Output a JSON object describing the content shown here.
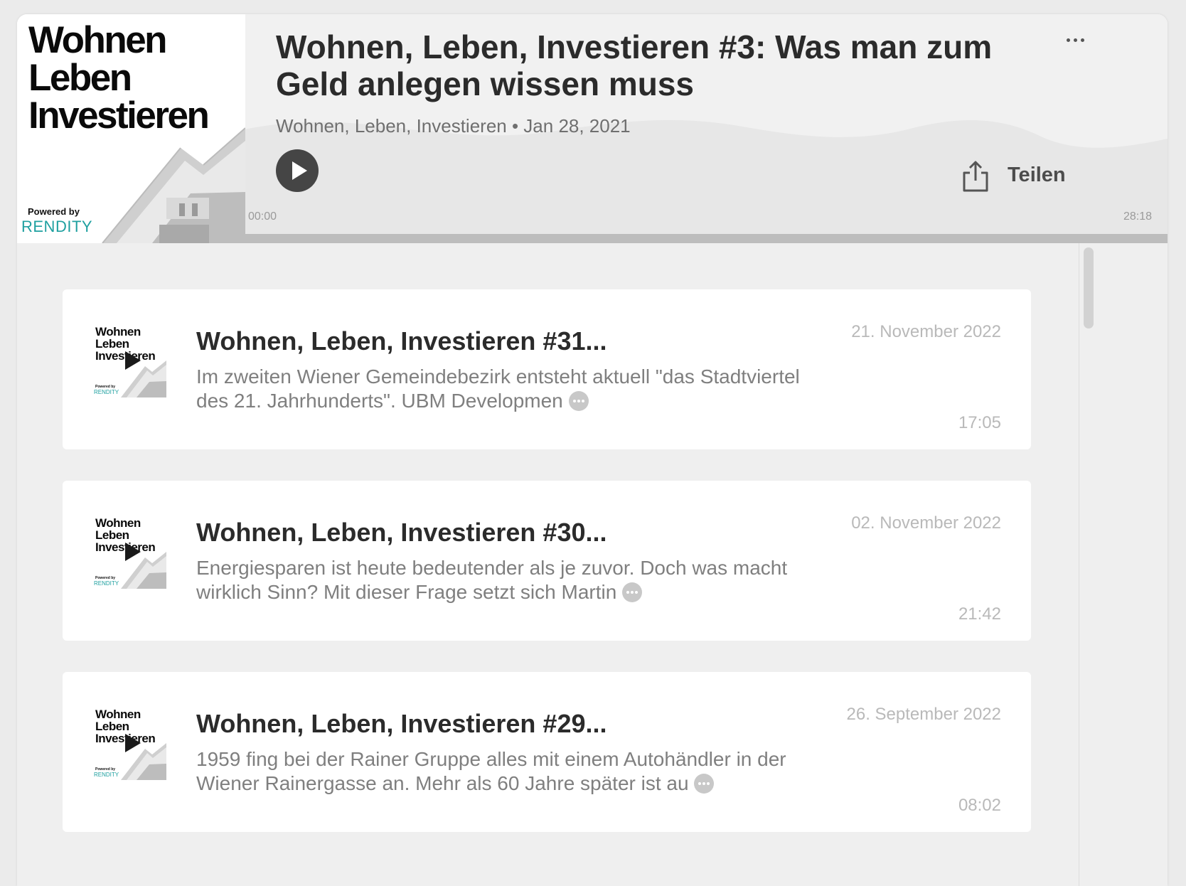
{
  "player": {
    "cover": {
      "title": "Wohnen\nLeben\nInvestieren",
      "powered_by": "Powered by",
      "brand": "RENDITY"
    },
    "episode_title": "Wohnen, Leben, Investieren #3: Was man zum Geld anlegen wissen muss",
    "meta": "Wohnen, Leben, Investieren • Jan 28, 2021",
    "share_label": "Teilen",
    "time_current": "00:00",
    "time_total": "28:18",
    "progress": 0.0
  },
  "episodes": [
    {
      "title": "Wohnen, Leben, Investieren #31...",
      "description": "Im zweiten Wiener Gemeindebezirk entsteht aktuell \"das Stadtviertel des 21. Jahrhunderts\". UBM Developmen",
      "date": "21. November 2022",
      "duration": "17:05"
    },
    {
      "title": "Wohnen, Leben, Investieren #30...",
      "description": "Energiesparen ist heute bedeutender als je zuvor. Doch was macht wirklich Sinn? Mit dieser Frage setzt sich Martin",
      "date": "02. November 2022",
      "duration": "21:42"
    },
    {
      "title": "Wohnen, Leben, Investieren #29...",
      "description": "1959 fing bei der Rainer Gruppe alles mit einem Autohändler in der Wiener Rainergasse an. Mehr als 60 Jahre später ist au",
      "date": "26. September 2022",
      "duration": "08:02"
    }
  ],
  "thumb": {
    "title": "Wohnen\nLeben\nInvestieren",
    "powered_by": "Powered by",
    "brand": "RENDITY"
  },
  "icons": {
    "play": "play-icon",
    "share": "share-icon",
    "more": "more-dots-icon",
    "expand": "ellipsis-icon"
  },
  "colors": {
    "brand": "#1fa0a0",
    "play_bg": "#454545",
    "text": "#2b2b2b"
  }
}
